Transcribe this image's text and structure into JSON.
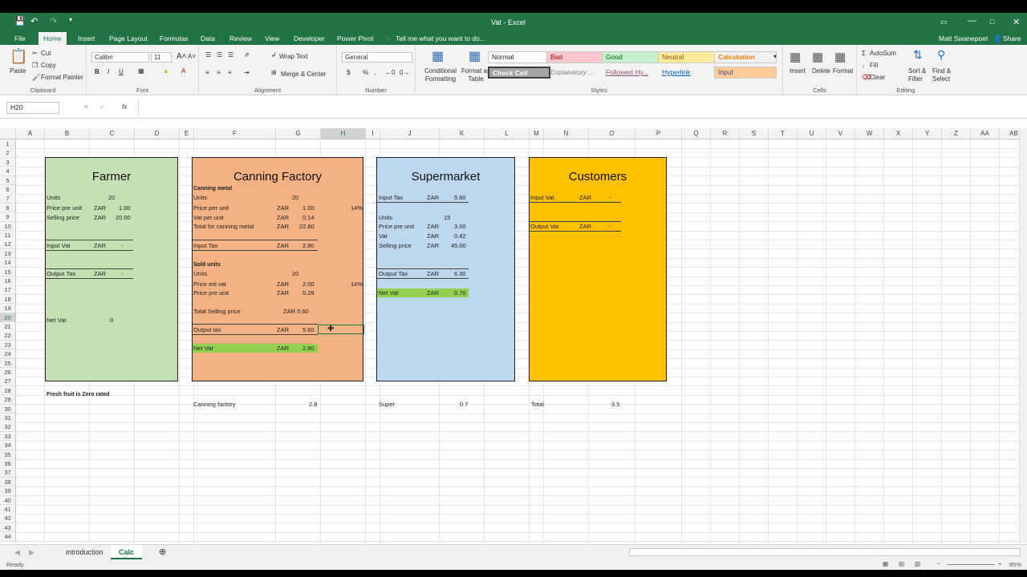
{
  "window": {
    "title": "Vat - Excel",
    "user": "Matt Swanepoel",
    "share": "Share"
  },
  "ribbon_tabs": [
    "File",
    "Home",
    "Insert",
    "Page Layout",
    "Formulas",
    "Data",
    "Review",
    "View",
    "Developer",
    "Power Pivot"
  ],
  "tell_me": "Tell me what you want to do...",
  "clipboard": {
    "paste": "Paste",
    "cut": "Cut",
    "copy": "Copy",
    "format_painter": "Format Painter",
    "label": "Clipboard"
  },
  "font": {
    "name": "Calibri",
    "size": "11",
    "label": "Font"
  },
  "alignment": {
    "wrap": "Wrap Text",
    "merge": "Merge & Center",
    "label": "Alignment"
  },
  "number": {
    "format": "General",
    "label": "Number"
  },
  "styles": {
    "cond": "Conditional Formatting",
    "fmt_table": "Format as Table",
    "normal": "Normal",
    "bad": "Bad",
    "good": "Good",
    "neutral": "Neutral",
    "calculation": "Calculation",
    "check_cell": "Check Cell",
    "explanatory": "Explanatory ...",
    "followed": "Followed Hy...",
    "hyperlink": "Hyperlink",
    "input": "Input",
    "label": "Styles"
  },
  "cells": {
    "insert": "Insert",
    "delete": "Delete",
    "format": "Format",
    "label": "Cells"
  },
  "editing": {
    "autosum": "AutoSum",
    "fill": "Fill",
    "clear": "Clear",
    "sort": "Sort & Filter",
    "find": "Find & Select",
    "label": "Editing"
  },
  "formula_bar": {
    "name_box": "H20",
    "formula": ""
  },
  "columns": [
    "A",
    "B",
    "C",
    "D",
    "E",
    "F",
    "G",
    "H",
    "I",
    "J",
    "K",
    "L",
    "M",
    "N",
    "O",
    "P",
    "Q",
    "R",
    "S",
    "T",
    "U",
    "V",
    "W",
    "X",
    "Y",
    "Z",
    "AA",
    "AB"
  ],
  "farmer": {
    "title": "Farmer",
    "units_l": "Units",
    "units_v": "20",
    "ppu_l": "Price pre unit",
    "ppu_c": "ZAR",
    "ppu_v": "1.00",
    "sp_l": "Selling price",
    "sp_c": "ZAR",
    "sp_v": "20.00",
    "iv_l": "Input Vat",
    "iv_c": "ZAR",
    "iv_v": "-",
    "ot_l": "Output Tax",
    "ot_c": "ZAR",
    "ot_v": "-",
    "nv_l": "Net Vat",
    "nv_v": "0",
    "note": "Fresh fruit is Zero rated"
  },
  "canning": {
    "title": "Canning Factory",
    "metal": "Canning metal",
    "units_l": "Units",
    "units_v": "20",
    "ppu_l": "Price per unit",
    "ppu_c": "ZAR",
    "ppu_v": "1.00",
    "rate1": "14%",
    "vpu_l": "Vat per unit",
    "vpu_c": "ZAR",
    "vpu_v": "0.14",
    "tot_l": "Total for canning metal",
    "tot_c": "ZAR",
    "tot_v": "22.80",
    "it_l": "Input Tax",
    "it_c": "ZAR",
    "it_v": "2.80",
    "sold": "Sold units",
    "units2_l": "Units",
    "units2_v": "20",
    "pev_l": "Price exl vat",
    "pev_c": "ZAR",
    "pev_v": "2.00",
    "rate2": "14%",
    "ppu2_l": "Price pre unit",
    "ppu2_c": "ZAR",
    "ppu2_v": "0.28",
    "tsp_l": "Total Selling price",
    "tsp_v": "ZAR 5.60",
    "ot_l": "Output tax",
    "ot_c": "ZAR",
    "ot_v": "5.60",
    "nv_l": "Net Vat",
    "nv_c": "ZAR",
    "nv_v": "2.80",
    "sum_l": "Canning factory",
    "sum_v": "2.8"
  },
  "supermarket": {
    "title": "Supermarket",
    "it_l": "Input Tax",
    "it_c": "ZAR",
    "it_v": "5.60",
    "units_l": "Units",
    "units_v": "15",
    "ppu_l": "Price pre unit",
    "ppu_c": "ZAR",
    "ppu_v": "3.00",
    "vat_l": "Vat",
    "vat_c": "ZAR",
    "vat_v": "0.42",
    "sp_l": "Selling price",
    "sp_c": "ZAR",
    "sp_v": "45.00",
    "ot_l": "Output Tax",
    "ot_c": "ZAR",
    "ot_v": "6.30",
    "nv_l": "Net Vat",
    "nv_c": "ZAR",
    "nv_v": "0.70",
    "sum_l": "Super",
    "sum_v": "0.7"
  },
  "customers": {
    "title": "Customers",
    "iv_l": "Input Vat",
    "iv_c": "ZAR",
    "iv_v": "-",
    "ov_l": "Output Vat",
    "ov_c": "ZAR",
    "ov_v": "-",
    "sum_l": "Total",
    "sum_v": "3.5"
  },
  "sheets": [
    "introduction",
    "Calc"
  ],
  "status": {
    "ready": "Ready",
    "zoom": "85%"
  },
  "colors": {
    "excel_green": "#217346",
    "farmer": "#c5e0b4",
    "canning": "#f4b183",
    "supermarket": "#bdd7ee",
    "customers": "#ffc000",
    "netvat": "#92d050"
  }
}
